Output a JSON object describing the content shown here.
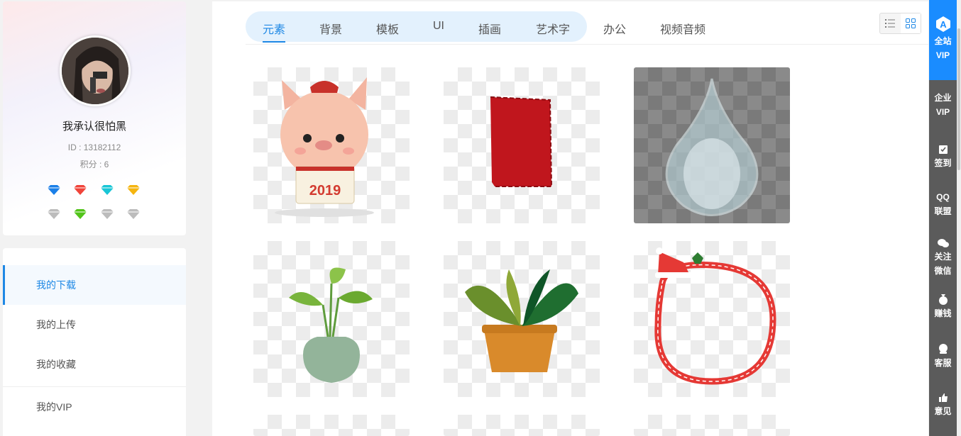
{
  "profile": {
    "username": "我承认很怕黑",
    "id_text": "ID : 13182112",
    "points_text": "积分 : 6",
    "badges_row1": [
      "blue-diamond-icon",
      "red-diamond-icon",
      "cyan-diamond-icon",
      "gold-diamond-icon"
    ],
    "badges_row2": [
      "gray-diamond-icon",
      "green-diamond-icon",
      "gray-diamond-icon",
      "gray-diamond-icon"
    ]
  },
  "menu": {
    "items": [
      {
        "label": "我的下载",
        "active": true
      },
      {
        "label": "我的上传",
        "active": false
      },
      {
        "label": "我的收藏",
        "active": false
      },
      {
        "label": "我的VIP",
        "active": false
      }
    ]
  },
  "tabs": {
    "items": [
      "元素",
      "背景",
      "模板",
      "UI",
      "插画",
      "艺术字",
      "办公",
      "视频音频"
    ],
    "active": "元素"
  },
  "view_toggle": {
    "options": [
      "list-view-icon",
      "grid-view-icon"
    ],
    "selected": "grid-view-icon"
  },
  "grid": {
    "items": [
      {
        "name": "pig-2019-element",
        "text": "2019"
      },
      {
        "name": "red-seal-stamp-element"
      },
      {
        "name": "water-drop-element"
      },
      {
        "name": "potted-green-plant-element"
      },
      {
        "name": "potted-leaf-plant-element"
      },
      {
        "name": "christmas-hat-frame-element"
      }
    ]
  },
  "right_sidebar": {
    "items": [
      {
        "icon": "vip-a-icon",
        "label1": "全站",
        "label2": "VIP"
      },
      {
        "icon": "",
        "label1": "企业",
        "label2": "VIP"
      },
      {
        "icon": "checkin-icon",
        "label1": "签到",
        "label2": ""
      },
      {
        "icon": "",
        "label1": "QQ",
        "label2": "联盟"
      },
      {
        "icon": "wechat-icon",
        "label1": "关注",
        "label2": "微信"
      },
      {
        "icon": "money-bag-icon",
        "label1": "赚钱",
        "label2": ""
      },
      {
        "icon": "customer-service-icon",
        "label1": "客服",
        "label2": ""
      },
      {
        "icon": "thumbs-up-icon",
        "label1": "意见",
        "label2": ""
      }
    ]
  },
  "colors": {
    "accent": "#1e88e5",
    "sidebar_active": "#1a8cff",
    "sidebar_bg": "#5b5b5b"
  }
}
